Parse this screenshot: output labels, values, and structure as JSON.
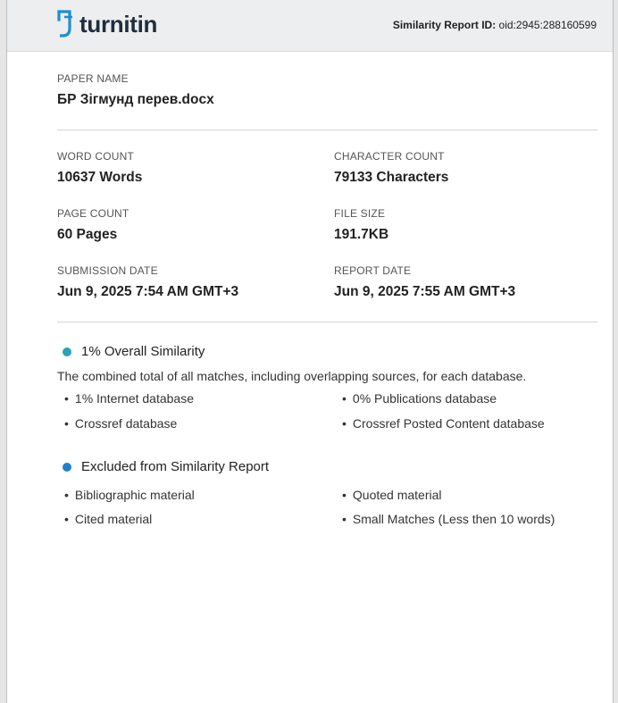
{
  "header": {
    "logo_text": "turnitin",
    "report_id_label": "Similarity Report ID:",
    "report_id_value": "oid:2945:288160599",
    "logo_color": "#1d8fce"
  },
  "paper": {
    "name_label": "PAPER NAME",
    "name_value": "БР Зігмунд перев.docx"
  },
  "stats": {
    "word_count_label": "WORD COUNT",
    "word_count_value": "10637 Words",
    "character_count_label": "CHARACTER COUNT",
    "character_count_value": "79133 Characters",
    "page_count_label": "PAGE COUNT",
    "page_count_value": "60 Pages",
    "file_size_label": "FILE SIZE",
    "file_size_value": "191.7KB",
    "submission_date_label": "SUBMISSION DATE",
    "submission_date_value": "Jun 9, 2025 7:54 AM GMT+3",
    "report_date_label": "REPORT DATE",
    "report_date_value": "Jun 9, 2025 7:55 AM GMT+3"
  },
  "similarity": {
    "title": "1% Overall Similarity",
    "dot_color": "#2aa3b8",
    "description": "The combined total of all matches, including overlapping sources, for each database.",
    "items": [
      "1% Internet database",
      "0% Publications database",
      "Crossref database",
      "Crossref Posted Content database"
    ]
  },
  "excluded": {
    "title": "Excluded from Similarity Report",
    "dot_color": "#1e7fd1",
    "items": [
      "Bibliographic material",
      "Quoted material",
      "Cited material",
      "Small Matches (Less then 10 words)"
    ]
  }
}
